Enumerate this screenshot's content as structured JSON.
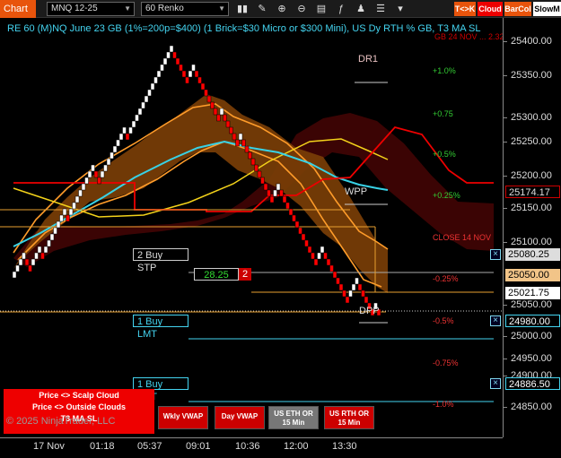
{
  "toolbar": {
    "tab_label": "Chart",
    "instrument": "MNQ 12-25",
    "interval": "60 Renko",
    "buttons": {
      "tk": "T<>K",
      "cloud": "Cloud",
      "barcol": "BarCol",
      "slowma": "SlowM"
    },
    "icons": [
      "bars-icon",
      "draw-icon",
      "zoom-in-icon",
      "zoom-out-icon",
      "properties-icon",
      "indicators-icon",
      "strategies-icon",
      "chart-trader-icon"
    ]
  },
  "chart": {
    "title": "RE 60 (M)NQ June 23 GB (1%=200p=$400) (1 Brick=$30 Micro or $300 Mini), US Dy RTH % GB, T3 MA SL",
    "price_ticks": [
      "25400.00",
      "25350.00",
      "25300.00",
      "25250.00",
      "25200.00",
      "25150.00",
      "25100.00",
      "25050.00",
      "25000.00",
      "24950.00",
      "24900.00",
      "24850.00"
    ],
    "time_ticks": [
      "17 Nov",
      "01:18",
      "05:37",
      "09:01",
      "10:36",
      "12:00",
      "13:30"
    ],
    "price_labels": {
      "p1": "25174.17",
      "p2": "25080.25",
      "p3": "25050.00",
      "p4": "25021.75",
      "p5": "24980.00",
      "p6": "24886.50"
    },
    "pivots": {
      "dr1": "DR1",
      "wpp": "WPP",
      "dpp": "DPP"
    },
    "percent_labels": {
      "p_plus1": "+1.0%",
      "p_plus075": "+0.75",
      "p_plus05": "+0.5%",
      "p_plus025": "+0.25%",
      "p_minus025": "-0.25%",
      "p_minus05": "-0.5%",
      "p_minus075": "-0.75%",
      "p_minus1": "-1.0%",
      "close_label": "CLOSE 14 NOV",
      "top_red": "GB 24 NOV ... 2.32"
    },
    "orders": {
      "buy_stp": "2 Buy STP",
      "buy_lmt1": "1 Buy LMT",
      "buy_lmt2": "1 Buy LMT",
      "pnl": "28.25",
      "qty": "2"
    },
    "close_icon": "x-icon"
  },
  "bottom": {
    "scalp": "Price <> Scalp Cloud",
    "outside": "Price <> Outside Clouds",
    "t3": "T3 MA SL",
    "copyright": "© 2025 NinjaTrader, LLC",
    "btn_wkly": "Wkly VWAP",
    "btn_day": "Day VWAP",
    "btn_eth": "US ETH OR 15 Min",
    "btn_rth": "US RTH OR 15 Min"
  },
  "colors": {
    "accent": "#e8540c",
    "cyan": "#44d4f0",
    "up_brick": "#ffffff",
    "down_brick": "#ff0000",
    "orange_cloud": "#b3600a",
    "dark_red_cloud": "#4a0000"
  }
}
